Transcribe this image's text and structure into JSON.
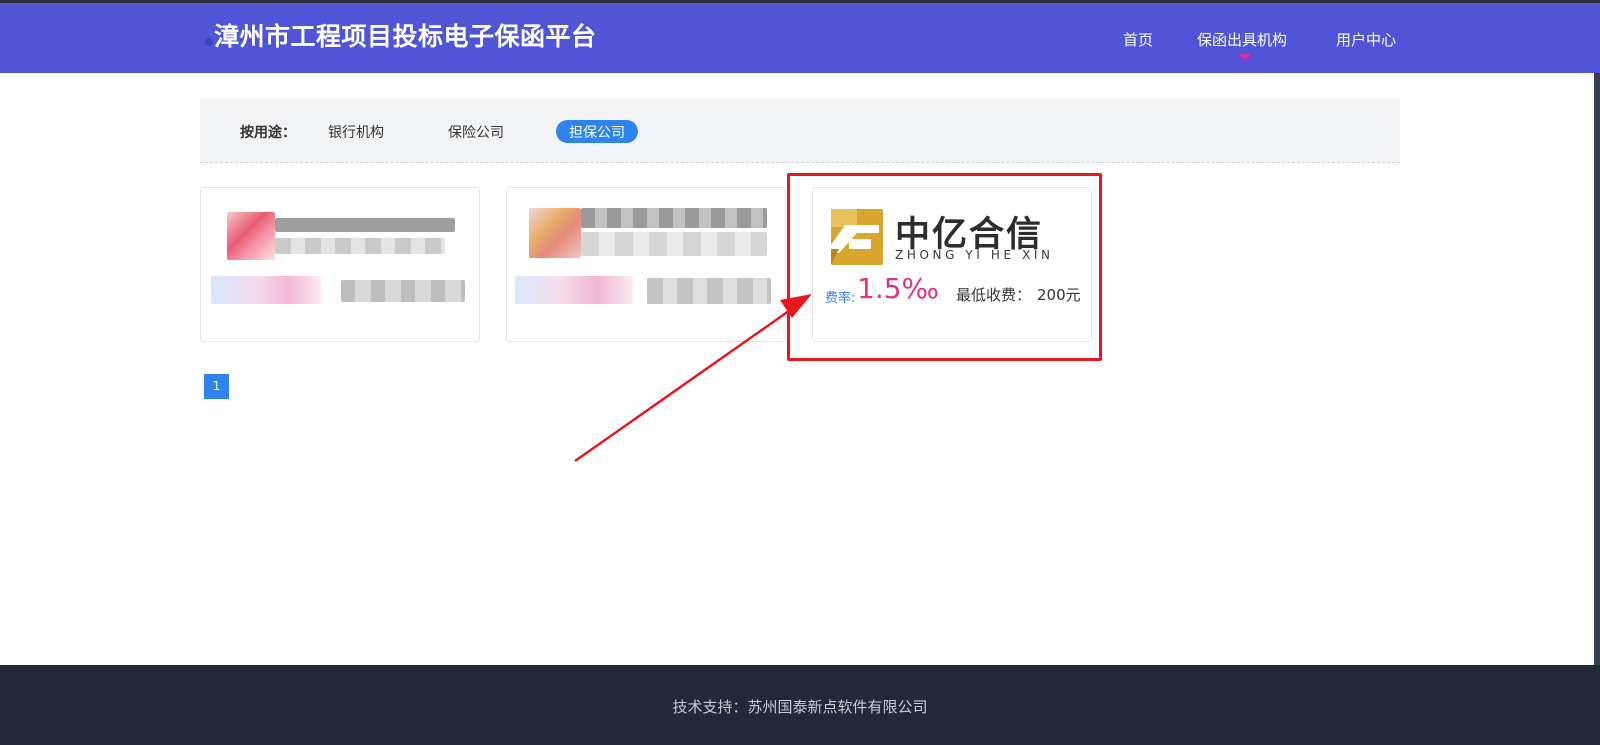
{
  "header": {
    "site_title": "漳州市工程项目投标电子保函平台",
    "nav": [
      "首页",
      "保函出具机构",
      "用户中心"
    ],
    "active_nav": "保函出具机构"
  },
  "filter": {
    "label": "按用途：",
    "options": [
      "银行机构",
      "保险公司",
      "担保公司"
    ],
    "selected": "担保公司"
  },
  "cards": [
    {
      "state": "blurred"
    },
    {
      "state": "blurred"
    },
    {
      "logo_cn": "中亿合信",
      "logo_en": "ZHONG YI HE XIN",
      "rate_label": "费率:",
      "rate_value": "1.5‰",
      "min_fee_label": "最低收费：",
      "min_fee_value": "200元"
    }
  ],
  "pagination": {
    "current": "1"
  },
  "footer": {
    "text": "技术支持：苏州国泰新点软件有限公司"
  },
  "colors": {
    "header_bg": "#5055d8",
    "accent": "#2f83ec",
    "rate": "#e0328a",
    "highlight": "#e8171f",
    "footer_bg": "#222838"
  }
}
